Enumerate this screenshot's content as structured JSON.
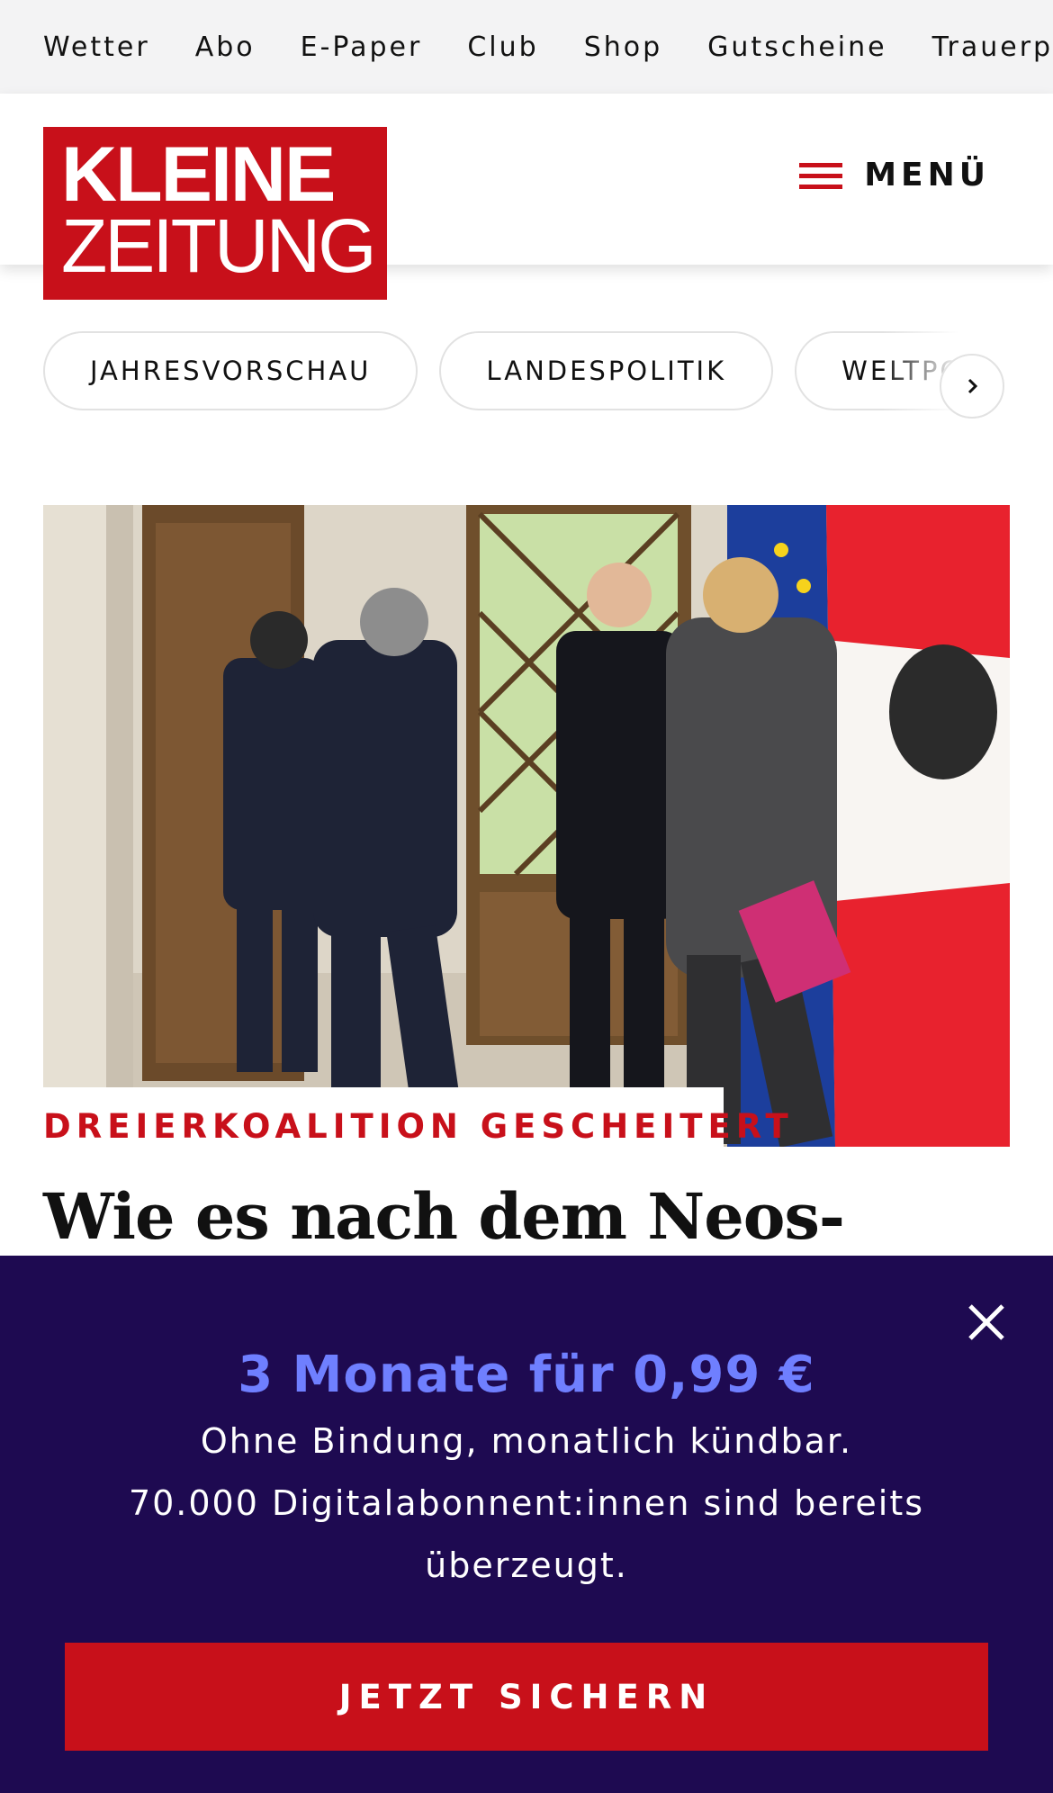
{
  "topnav": {
    "items": [
      "Wetter",
      "Abo",
      "E-Paper",
      "Club",
      "Shop",
      "Gutscheine",
      "Trauerportal"
    ]
  },
  "header": {
    "logo_line1": "KLEINE",
    "logo_line2": "ZEITUNG",
    "menu_label": "MENÜ"
  },
  "chips": {
    "items": [
      "JAHRESVORSCHAU",
      "LANDESPOLITIK",
      "WELTPOLITIK"
    ]
  },
  "article": {
    "kicker": "DREIERKOALITION GESCHEITERT",
    "headline": "Wie es nach dem Neos-"
  },
  "paywall": {
    "offer_title": "3 Monate für 0,99 €",
    "line1": "Ohne Bindung, monatlich kündbar.",
    "line2": "70.000 Digitalabonnent:innen sind bereits überzeugt.",
    "cta_label": "JETZT SICHERN"
  },
  "colors": {
    "brand_red": "#c8101a",
    "paywall_bg": "#1e0a51",
    "offer_accent": "#6f7fff"
  },
  "icons": {
    "menu": "hamburger-icon",
    "chips_next": "chevron-right-icon",
    "close": "close-icon"
  }
}
